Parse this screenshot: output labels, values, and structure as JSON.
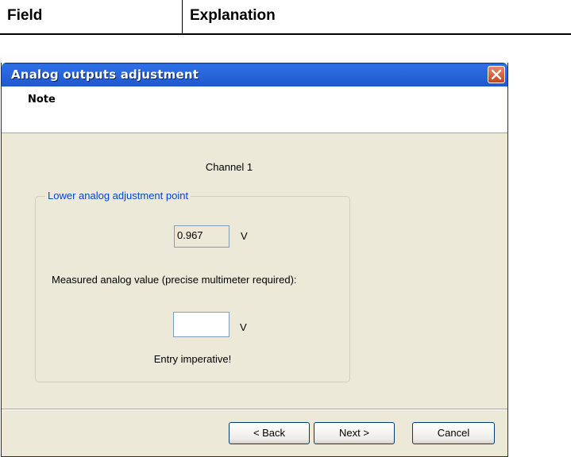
{
  "table_header": {
    "field": "Field",
    "explanation": "Explanation"
  },
  "dialog": {
    "title": "Analog outputs adjustment",
    "close_icon": "close-icon",
    "header_title": "Note",
    "channel_label": "Channel 1",
    "group_title": "Lower analog adjustment point",
    "readonly_value": "0.967",
    "unit": "V",
    "measured_label": "Measured analog value (precise multimeter required):",
    "measured_input_value": "",
    "entry_note": "Entry imperative!",
    "buttons": {
      "back": "< Back",
      "next": "Next >",
      "cancel": "Cancel"
    }
  },
  "colors": {
    "titlebar": "#2a68de",
    "dialog_bg": "#ece9d8",
    "group_title": "#0046d5",
    "close_button": "#c9421d"
  }
}
